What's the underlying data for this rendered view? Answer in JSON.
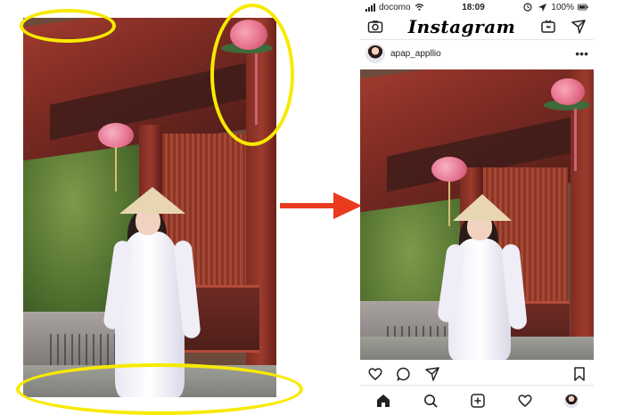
{
  "phone": {
    "status": {
      "carrier": "docomo",
      "time": "18:09",
      "battery_percent": "100%"
    },
    "header": {
      "brand": "Instagram"
    },
    "post": {
      "username": "apap_appllio"
    }
  },
  "icons": {
    "camera": "camera-icon",
    "igtv": "igtv-icon",
    "direct": "direct-icon",
    "more": "more-icon",
    "like": "heart-icon",
    "comment": "comment-icon",
    "share": "share-icon",
    "bookmark": "bookmark-icon",
    "home": "home-icon",
    "search": "search-icon",
    "add": "add-post-icon",
    "activity": "activity-heart-icon",
    "profile": "profile-avatar-icon"
  },
  "annotation_colors": {
    "highlight": "#f7ea00",
    "arrow": "#ea3b1f"
  }
}
